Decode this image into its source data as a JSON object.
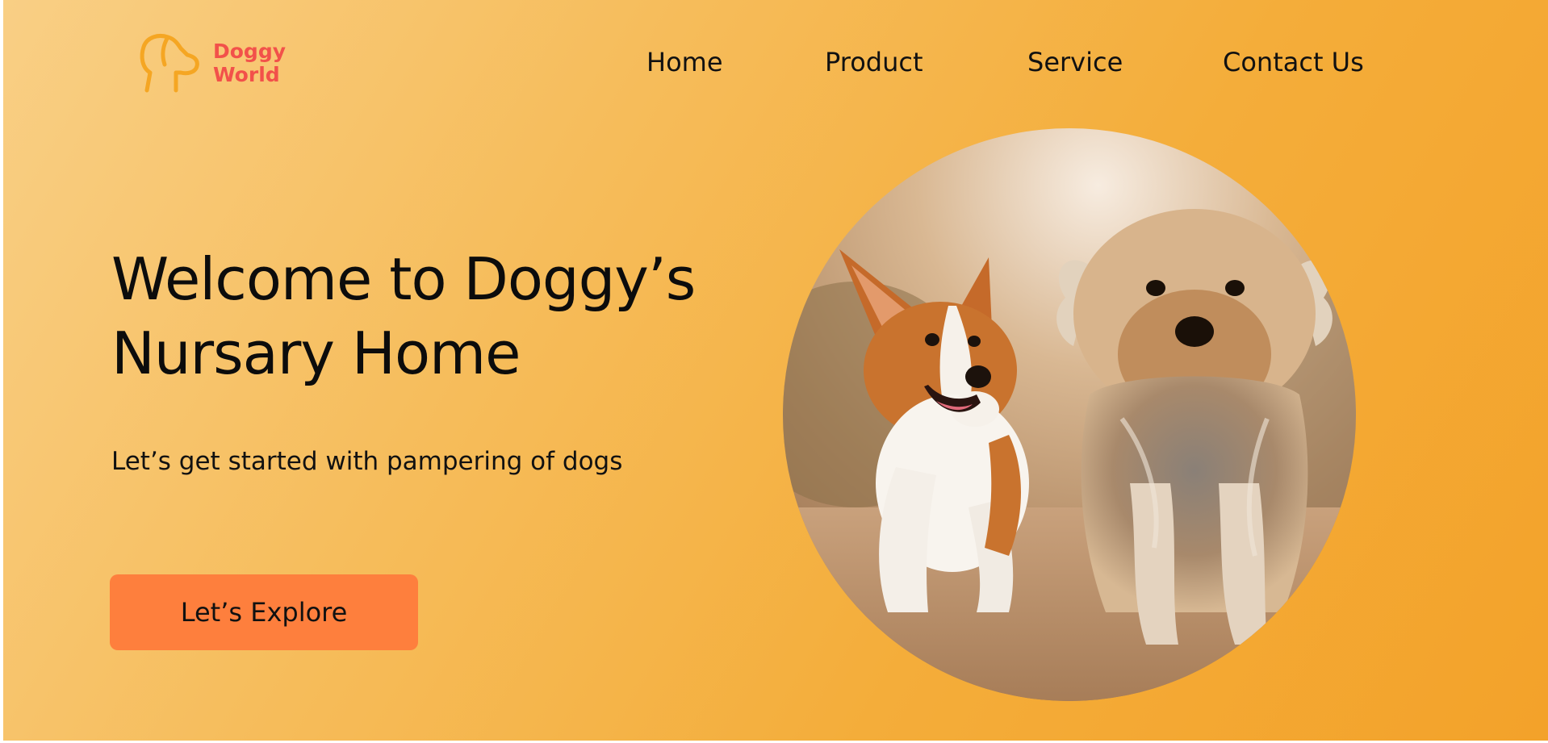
{
  "brand": {
    "name_line1": "Doggy",
    "name_line2": "World",
    "logo_icon": "dog-head-outline-icon",
    "logo_color": "#f5a623",
    "text_color": "#f2514a"
  },
  "nav": {
    "items": [
      {
        "label": "Home"
      },
      {
        "label": "Product"
      },
      {
        "label": "Service"
      },
      {
        "label": "Contact Us"
      }
    ]
  },
  "hero": {
    "title_line1": "Welcome to Doggy’s",
    "title_line2": "Nursary Home",
    "subtitle": "Let’s get started with pampering of dogs",
    "cta_label": "Let’s Explore",
    "cta_color": "#fe7f3d",
    "image": "two-dogs-photo"
  },
  "colors": {
    "background_start": "#f9cf85",
    "background_end": "#f3a22a",
    "text": "#111111"
  }
}
